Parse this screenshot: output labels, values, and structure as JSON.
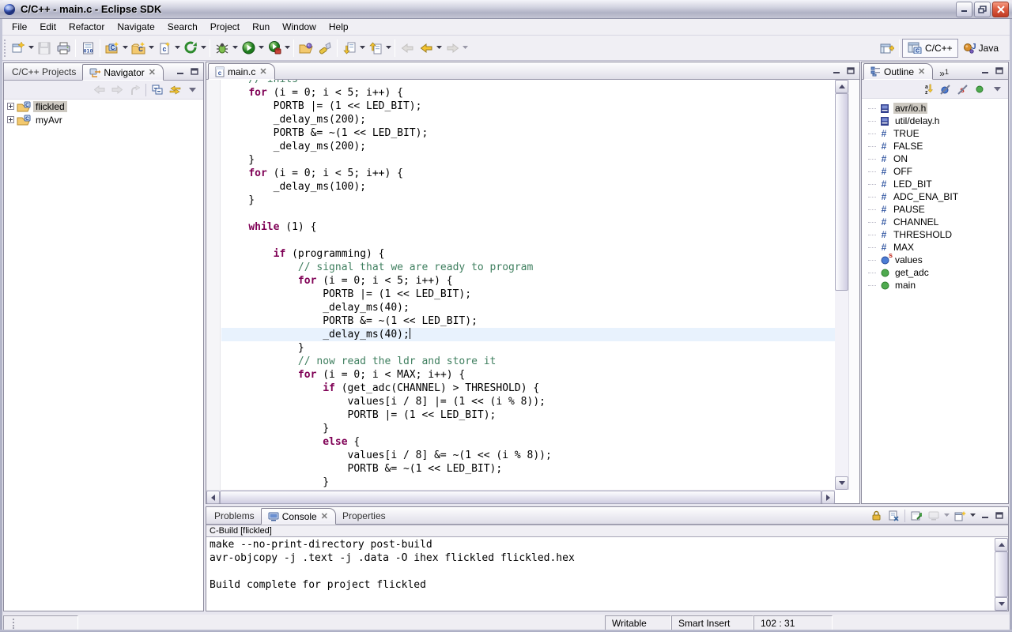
{
  "window": {
    "title": "C/C++ - main.c - Eclipse SDK"
  },
  "menubar": {
    "items": [
      "File",
      "Edit",
      "Refactor",
      "Navigate",
      "Search",
      "Project",
      "Run",
      "Window",
      "Help"
    ]
  },
  "toolbar": {
    "perspectives": {
      "cpp": "C/C++",
      "java": "Java"
    }
  },
  "sidebar": {
    "tabs": [
      {
        "label": "C/C++ Projects"
      },
      {
        "label": "Navigator"
      }
    ],
    "tree": [
      {
        "label": "flickled",
        "selected": true
      },
      {
        "label": "myAvr",
        "selected": false
      }
    ]
  },
  "editor": {
    "tab": "main.c",
    "code_lines": [
      {
        "s": [
          [
            "c",
            "    // inits"
          ]
        ]
      },
      {
        "s": [
          [
            "p",
            "    "
          ],
          [
            "k",
            "for"
          ],
          [
            "p",
            " (i = 0; i < 5; i++) {"
          ]
        ]
      },
      {
        "s": [
          [
            "p",
            "        PORTB |= (1 << LED_BIT);"
          ]
        ]
      },
      {
        "s": [
          [
            "p",
            "        _delay_ms(200);"
          ]
        ]
      },
      {
        "s": [
          [
            "p",
            "        PORTB &= ~(1 << LED_BIT);"
          ]
        ]
      },
      {
        "s": [
          [
            "p",
            "        _delay_ms(200);"
          ]
        ]
      },
      {
        "s": [
          [
            "p",
            "    }"
          ]
        ]
      },
      {
        "s": [
          [
            "p",
            "    "
          ],
          [
            "k",
            "for"
          ],
          [
            "p",
            " (i = 0; i < 5; i++) {"
          ]
        ]
      },
      {
        "s": [
          [
            "p",
            "        _delay_ms(100);"
          ]
        ]
      },
      {
        "s": [
          [
            "p",
            "    }"
          ]
        ]
      },
      {
        "s": []
      },
      {
        "s": [
          [
            "p",
            "    "
          ],
          [
            "k",
            "while"
          ],
          [
            "p",
            " (1) {"
          ]
        ]
      },
      {
        "s": []
      },
      {
        "s": [
          [
            "p",
            "        "
          ],
          [
            "k",
            "if"
          ],
          [
            "p",
            " (programming) {"
          ]
        ]
      },
      {
        "s": [
          [
            "c",
            "            // signal that we are ready to program"
          ]
        ]
      },
      {
        "s": [
          [
            "p",
            "            "
          ],
          [
            "k",
            "for"
          ],
          [
            "p",
            " (i = 0; i < 5; i++) {"
          ]
        ]
      },
      {
        "s": [
          [
            "p",
            "                PORTB |= (1 << LED_BIT);"
          ]
        ]
      },
      {
        "s": [
          [
            "p",
            "                _delay_ms(40);"
          ]
        ]
      },
      {
        "s": [
          [
            "p",
            "                PORTB &= ~(1 << LED_BIT);"
          ]
        ]
      },
      {
        "s": [
          [
            "p",
            "                _delay_ms(40);"
          ]
        ],
        "hl": true,
        "caret": true
      },
      {
        "s": [
          [
            "p",
            "            }"
          ]
        ]
      },
      {
        "s": [
          [
            "c",
            "            // now read the ldr and store it"
          ]
        ]
      },
      {
        "s": [
          [
            "p",
            "            "
          ],
          [
            "k",
            "for"
          ],
          [
            "p",
            " (i = 0; i < MAX; i++) {"
          ]
        ]
      },
      {
        "s": [
          [
            "p",
            "                "
          ],
          [
            "k",
            "if"
          ],
          [
            "p",
            " (get_adc(CHANNEL) > THRESHOLD) {"
          ]
        ]
      },
      {
        "s": [
          [
            "p",
            "                    values[i / 8] |= (1 << (i % 8));"
          ]
        ]
      },
      {
        "s": [
          [
            "p",
            "                    PORTB |= (1 << LED_BIT);"
          ]
        ]
      },
      {
        "s": [
          [
            "p",
            "                }"
          ]
        ]
      },
      {
        "s": [
          [
            "p",
            "                "
          ],
          [
            "k",
            "else"
          ],
          [
            "p",
            " {"
          ]
        ]
      },
      {
        "s": [
          [
            "p",
            "                    values[i / 8] &= ~(1 << (i % 8));"
          ]
        ]
      },
      {
        "s": [
          [
            "p",
            "                    PORTB &= ~(1 << LED_BIT);"
          ]
        ]
      },
      {
        "s": [
          [
            "p",
            "                }"
          ]
        ]
      }
    ]
  },
  "outline": {
    "tab": "Outline",
    "hidden_count": "1",
    "items": [
      {
        "label": "avr/io.h",
        "icon": "include",
        "selected": true
      },
      {
        "label": "util/delay.h",
        "icon": "include"
      },
      {
        "label": "TRUE",
        "icon": "define"
      },
      {
        "label": "FALSE",
        "icon": "define"
      },
      {
        "label": "ON",
        "icon": "define"
      },
      {
        "label": "OFF",
        "icon": "define"
      },
      {
        "label": "LED_BIT",
        "icon": "define"
      },
      {
        "label": "ADC_ENA_BIT",
        "icon": "define"
      },
      {
        "label": "PAUSE",
        "icon": "define"
      },
      {
        "label": "CHANNEL",
        "icon": "define"
      },
      {
        "label": "THRESHOLD",
        "icon": "define"
      },
      {
        "label": "MAX",
        "icon": "define"
      },
      {
        "label": "values",
        "icon": "static-variable"
      },
      {
        "label": "get_adc",
        "icon": "function"
      },
      {
        "label": "main",
        "icon": "function"
      }
    ]
  },
  "console": {
    "tabs": [
      "Problems",
      "Console",
      "Properties"
    ],
    "active_tab": "Console",
    "title": "C-Build [flickled]",
    "lines": [
      "make --no-print-directory post-build",
      "avr-objcopy -j .text -j .data -O ihex flickled flickled.hex",
      "",
      "Build complete for project flickled"
    ]
  },
  "statusbar": {
    "writable": "Writable",
    "insert_mode": "Smart Insert",
    "position": "102 : 31"
  },
  "colors": {
    "keyword": "#7f0055",
    "comment": "#3f7f5f",
    "line_highlight": "#e8f2fd",
    "selection": "#cdc9c1"
  }
}
